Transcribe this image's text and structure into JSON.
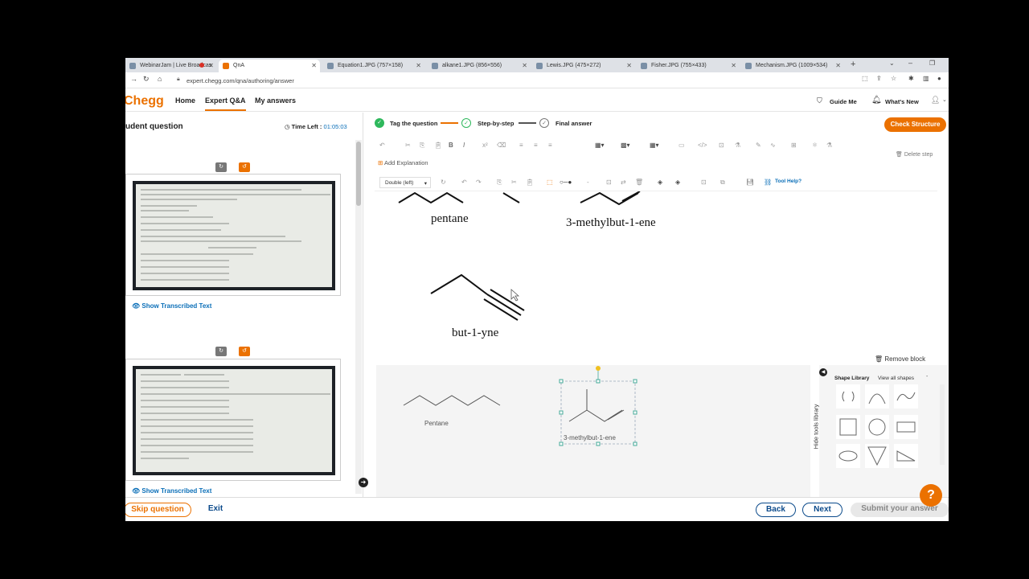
{
  "browser": {
    "tabs": [
      {
        "label": "WebinarJam | Live Broadcas",
        "active": false
      },
      {
        "label": "QnA",
        "active": true
      },
      {
        "label": "Equation1.JPG (757×158)",
        "active": false
      },
      {
        "label": "alkane1.JPG (856×556)",
        "active": false
      },
      {
        "label": "Lewis.JPG (475×272)",
        "active": false
      },
      {
        "label": "Fisher.JPG (755×433)",
        "active": false
      },
      {
        "label": "Mechanism.JPG (1009×534)",
        "active": false
      }
    ],
    "url": "expert.chegg.com/qna/authoring/answer"
  },
  "header": {
    "logo": "Chegg",
    "nav": [
      "Home",
      "Expert Q&A",
      "My answers"
    ],
    "active_nav": "Expert Q&A",
    "guide_me": "Guide Me",
    "whats_new": "What's New"
  },
  "left_panel": {
    "title": "udent question",
    "timer_label": "Time Left :",
    "timer_value": "01:05:03",
    "show_transcribed_1": "Show Transcribed Text",
    "show_transcribed_2": "Show Transcribed Text"
  },
  "steps": [
    {
      "label": "Tag the question",
      "status": "done"
    },
    {
      "label": "Step-by-step",
      "status": "current"
    },
    {
      "label": "Final answer",
      "status": "pending"
    }
  ],
  "check_structure": "Check Structure",
  "delete_step": "Delete step",
  "add_explanation": "Add Explanation",
  "toolbar": {
    "line_style": "Double (left)",
    "tool_help": "Tool Help?"
  },
  "molecules": {
    "pentane": "pentane",
    "methylbutene": "3-methylbut-1-ene",
    "butyne": "but-1-yne"
  },
  "remove_block": "Remove block",
  "canvas": {
    "label_pentane": "Pentane",
    "label_methylbutene": "3-methylbut-1-ene"
  },
  "shape_library": {
    "title": "Shape Library",
    "view_all": "View all shapes",
    "hide_tools": "Hide tools library"
  },
  "footer": {
    "skip": "Skip question",
    "exit": "Exit",
    "back": "Back",
    "next": "Next",
    "submit": "Submit your answer"
  },
  "help": "?",
  "colors": {
    "brand": "#eb7100",
    "link": "#0b6fb8",
    "success": "#2eb85c"
  }
}
